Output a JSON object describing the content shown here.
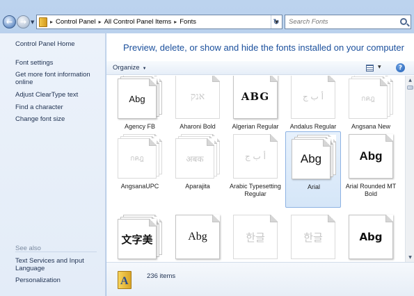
{
  "address": {
    "crumbs": [
      "Control Panel",
      "All Control Panel Items",
      "Fonts"
    ]
  },
  "search": {
    "placeholder": "Search Fonts"
  },
  "sidebar": {
    "home": "Control Panel Home",
    "links": [
      "Font settings",
      "Get more font information online",
      "Adjust ClearType text",
      "Find a character",
      "Change font size"
    ],
    "see_also_title": "See also",
    "see_also": [
      "Text Services and Input Language",
      "Personalization"
    ]
  },
  "main": {
    "heading": "Preview, delete, or show and hide the fonts installed on your computer",
    "organize_label": "Organize"
  },
  "fonts": [
    {
      "name": "Agency FB",
      "sample": "Abg",
      "stack": true,
      "faded": false
    },
    {
      "name": "Aharoni Bold",
      "sample": "אנק",
      "stack": false,
      "faded": true
    },
    {
      "name": "Algerian Regular",
      "sample": "ABG",
      "stack": false,
      "faded": false
    },
    {
      "name": "Andalus Regular",
      "sample": "أ ب ج",
      "stack": false,
      "faded": true
    },
    {
      "name": "Angsana New",
      "sample": "กคฎ",
      "stack": true,
      "faded": true
    },
    {
      "name": "AngsanaUPC",
      "sample": "กคฎ",
      "stack": true,
      "faded": true
    },
    {
      "name": "Aparajita",
      "sample": "अबक",
      "stack": true,
      "faded": true
    },
    {
      "name": "Arabic Typesetting Regular",
      "sample": "أ ب ج",
      "stack": false,
      "faded": true
    },
    {
      "name": "Arial",
      "sample": "Abg",
      "stack": true,
      "faded": false,
      "selected": true
    },
    {
      "name": "Arial Rounded MT Bold",
      "sample": "Abg",
      "stack": false,
      "faded": false
    },
    {
      "name": "",
      "sample": "文字美",
      "stack": true,
      "faded": false
    },
    {
      "name": "",
      "sample": "Abg",
      "stack": false,
      "faded": false
    },
    {
      "name": "",
      "sample": "한글",
      "stack": false,
      "faded": true
    },
    {
      "name": "",
      "sample": "한글",
      "stack": false,
      "faded": true
    },
    {
      "name": "",
      "sample": "Abg",
      "stack": false,
      "faded": false
    }
  ],
  "status": {
    "count": "236 items"
  },
  "colors": {
    "heading": "#1a4f9c",
    "pane": "#e3ecf8",
    "selection": "#d5e6f8"
  },
  "icons": [
    "back-arrow-icon",
    "forward-arrow-icon",
    "folder-icon",
    "refresh-icon",
    "search-icon",
    "views-icon",
    "help-icon",
    "fonts-folder-icon"
  ]
}
